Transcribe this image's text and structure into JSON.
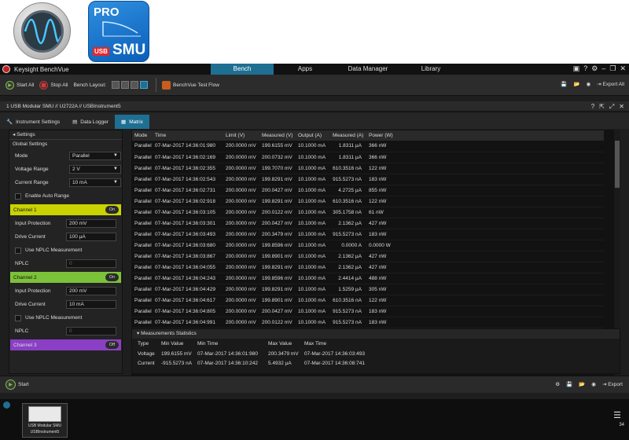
{
  "logos": {
    "smu_pro": "PRO",
    "smu_usb": "USB",
    "smu_name": "SMU"
  },
  "app": {
    "title": "Keysight BenchVue"
  },
  "nav": {
    "tabs": [
      "Bench",
      "Apps",
      "Data Manager",
      "Library"
    ],
    "active": "Bench"
  },
  "toolbar": {
    "start_all": "Start All",
    "stop_all": "Stop All",
    "bench_layout": "Bench Layout:",
    "test_flow": "BenchVue Test Flow",
    "export_all": "Export All"
  },
  "instrument": {
    "label": "1  USB Modular SMU // U2722A // USBInstrument5"
  },
  "subtabs": [
    "Instrument Settings",
    "Data Logger",
    "Matrix"
  ],
  "settings": {
    "header": "Settings",
    "global_header": "Global Settings",
    "mode_label": "Mode",
    "mode_value": "Parallel",
    "voltage_range_label": "Voltage Range",
    "voltage_range_value": "2 V",
    "current_range_label": "Current Range",
    "current_range_value": "10 mA",
    "auto_range_label": "Enable Auto Range",
    "channels": [
      {
        "name": "Channel 1",
        "state": "On",
        "input_protection": "200 mV",
        "drive_current": "100 µA",
        "nplc_label": "Use NPLC Measurement",
        "nplc": "0"
      },
      {
        "name": "Channel 2",
        "state": "On",
        "input_protection": "200 mV",
        "drive_current": "10 mA",
        "nplc_label": "Use NPLC Measurement",
        "nplc": "0"
      },
      {
        "name": "Channel 3",
        "state": "Off"
      }
    ],
    "input_protection_label": "Input Protection",
    "drive_current_label": "Drive Current",
    "nplc_field_label": "NPLC"
  },
  "table": {
    "columns": [
      "Mode",
      "Time",
      "Limit (V)",
      "Measured (V)",
      "Output (A)",
      "Measured (A)",
      "Power (W)"
    ],
    "rows": [
      [
        "Parallel",
        "07-Mar-2017 14:36:01:980",
        "200.0000 mV",
        "199.6155 mV",
        "10.1000 mA",
        "1.8311 µA",
        "366 nW"
      ],
      [
        "Parallel",
        "07-Mar-2017 14:36:02:169",
        "200.0000 mV",
        "200.0732 mV",
        "10.1000 mA",
        "1.8311 µA",
        "366 nW"
      ],
      [
        "Parallel",
        "07-Mar-2017 14:36:02:355",
        "200.0000 mV",
        "199.7070 mV",
        "10.1000 mA",
        "610.3516 nA",
        "122 nW"
      ],
      [
        "Parallel",
        "07-Mar-2017 14:36:02:543",
        "200.0000 mV",
        "199.8291 mV",
        "10.1000 mA",
        "915.5273 nA",
        "183 nW"
      ],
      [
        "Parallel",
        "07-Mar-2017 14:36:02:731",
        "200.0000 mV",
        "200.0427 mV",
        "10.1000 mA",
        "4.2725 µA",
        "855 nW"
      ],
      [
        "Parallel",
        "07-Mar-2017 14:36:02:918",
        "200.0000 mV",
        "199.8291 mV",
        "10.1000 mA",
        "610.3516 nA",
        "122 nW"
      ],
      [
        "Parallel",
        "07-Mar-2017 14:36:03:105",
        "200.0000 mV",
        "200.0122 mV",
        "10.1000 mA",
        "305.1758 nA",
        "61 nW"
      ],
      [
        "Parallel",
        "07-Mar-2017 14:36:03:301",
        "200.0000 mV",
        "200.0427 mV",
        "10.1000 mA",
        "2.1362 µA",
        "427 nW"
      ],
      [
        "Parallel",
        "07-Mar-2017 14:36:03:493",
        "200.0000 mV",
        "200.3479 mV",
        "10.1000 mA",
        "915.5273 nA",
        "183 nW"
      ],
      [
        "Parallel",
        "07-Mar-2017 14:36:03:680",
        "200.0000 mV",
        "199.8596 mV",
        "10.1000 mA",
        "0.0000 A",
        "0.0000 W"
      ],
      [
        "Parallel",
        "07-Mar-2017 14:36:03:867",
        "200.0000 mV",
        "199.8901 mV",
        "10.1000 mA",
        "2.1362 µA",
        "427 nW"
      ],
      [
        "Parallel",
        "07-Mar-2017 14:36:04:055",
        "200.0000 mV",
        "199.8291 mV",
        "10.1000 mA",
        "2.1362 µA",
        "427 nW"
      ],
      [
        "Parallel",
        "07-Mar-2017 14:36:04:243",
        "200.0000 mV",
        "199.8596 mV",
        "10.1000 mA",
        "2.4414 µA",
        "488 nW"
      ],
      [
        "Parallel",
        "07-Mar-2017 14:36:04:429",
        "200.0000 mV",
        "199.8291 mV",
        "10.1000 mA",
        "1.5259 µA",
        "305 nW"
      ],
      [
        "Parallel",
        "07-Mar-2017 14:36:04:617",
        "200.0000 mV",
        "199.8901 mV",
        "10.1000 mA",
        "610.3516 nA",
        "122 nW"
      ],
      [
        "Parallel",
        "07-Mar-2017 14:36:04:805",
        "200.0000 mV",
        "200.0427 mV",
        "10.1000 mA",
        "915.5273 nA",
        "183 nW"
      ],
      [
        "Parallel",
        "07-Mar-2017 14:36:04:991",
        "200.0000 mV",
        "200.0122 mV",
        "10.1000 mA",
        "915.5273 nA",
        "183 nW"
      ]
    ]
  },
  "stats": {
    "header": "Measurements Statistics",
    "columns": [
      "Type",
      "Min Value",
      "Min Time",
      "Max Value",
      "Max Time"
    ],
    "rows": [
      [
        "Voltage",
        "199.6155 mV",
        "07-Mar-2017 14:36:01:980",
        "200.3479 mV",
        "07-Mar-2017 14:36:03:493"
      ],
      [
        "Current",
        "-915.5273 nA",
        "07-Mar-2017 14:36:10:242",
        "5.4932 µA",
        "07-Mar-2017 14:36:08:741"
      ]
    ]
  },
  "bottom": {
    "start": "Start",
    "export": "Export"
  },
  "taskstrip": {
    "thumb_line1": "USB Modular SMU",
    "thumb_line2": "USBInstrument5",
    "badge": "34"
  }
}
